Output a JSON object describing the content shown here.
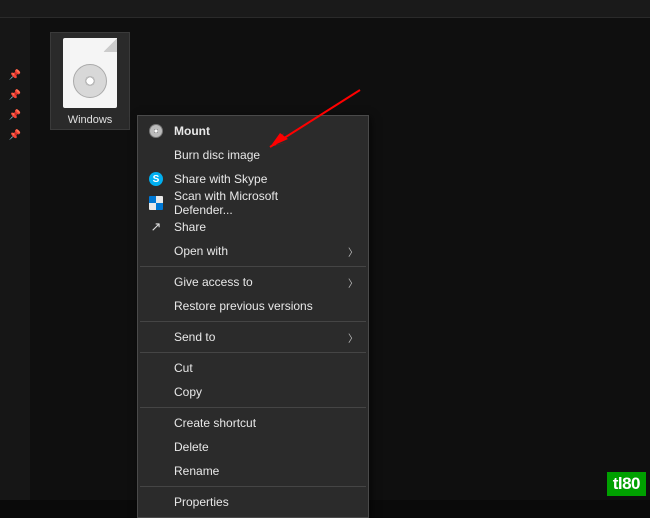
{
  "file": {
    "label": "Windows"
  },
  "context_menu": {
    "mount": "Mount",
    "burn": "Burn disc image",
    "skype": "Share with Skype",
    "defender": "Scan with Microsoft Defender...",
    "share": "Share",
    "open_with": "Open with",
    "give_access": "Give access to",
    "restore": "Restore previous versions",
    "send_to": "Send to",
    "cut": "Cut",
    "copy": "Copy",
    "shortcut": "Create shortcut",
    "delete": "Delete",
    "rename": "Rename",
    "properties": "Properties"
  },
  "watermark": "tl80",
  "annotation": {
    "arrow_target": "burn-disc-image-menu-item"
  },
  "colors": {
    "arrow": "#ff0000",
    "watermark_bg": "#00a000"
  }
}
